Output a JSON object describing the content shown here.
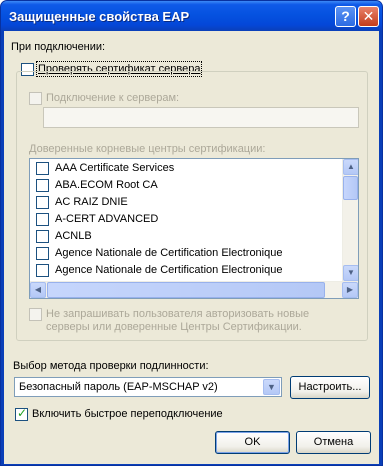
{
  "window": {
    "title": "Защищенные свойства EAP",
    "help_button": "?",
    "close_button": "✕"
  },
  "connect_label": "При подключении:",
  "verify_cert": {
    "label": "Проверять сертификат сервера",
    "checked": false
  },
  "connect_servers": {
    "label": "Подключение к серверам:",
    "checked": false,
    "value": ""
  },
  "trusted_ca": {
    "label": "Доверенные корневые центры сертификации:",
    "items": [
      "AAA Certificate Services",
      "ABA.ECOM Root CA",
      "AC RAIZ DNIE",
      "A-CERT ADVANCED",
      "ACNLB",
      "Agence Nationale de Certification Electronique",
      "Agence Nationale de Certification Electronique"
    ]
  },
  "no_prompt": {
    "label_line1": "Не запрашивать пользователя авторизовать новые",
    "label_line2": "серверы или доверенные Центры Сертификации.",
    "checked": false
  },
  "auth_method": {
    "label": "Выбор метода проверки подлинности:",
    "selected": "Безопасный пароль (EAP-MSCHAP v2)",
    "configure_button": "Настроить..."
  },
  "fast_reconnect": {
    "label": "Включить быстрое переподключение",
    "checked": true
  },
  "buttons": {
    "ok": "OK",
    "cancel": "Отмена"
  },
  "colors": {
    "titlebar": "#0552e0",
    "client_bg": "#ece9d8",
    "check_green": "#21a121"
  }
}
